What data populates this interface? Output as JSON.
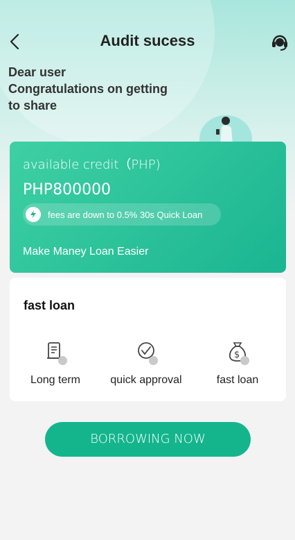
{
  "header": {
    "title": "Audit sucess"
  },
  "greeting": {
    "line1": "Dear user",
    "line2": "Congratulations on getting",
    "line3": "to share"
  },
  "credit": {
    "label": "available credit（PHP)",
    "amount": "PHP800000",
    "fee_text": "fees are down to 0.5% 30s Quick Loan",
    "slogan": "Make Maney Loan Easier"
  },
  "features": {
    "title": "fast loan",
    "items": [
      {
        "label": "Long term",
        "icon": "document-icon"
      },
      {
        "label": "quick approval",
        "icon": "check-circle-icon"
      },
      {
        "label": "fast loan",
        "icon": "money-bag-icon"
      }
    ]
  },
  "cta": {
    "label": "BORROWING NOW"
  },
  "colors": {
    "accent": "#14b58d",
    "card_gradient_start": "#3fd0a4",
    "card_gradient_end": "#1ab591"
  }
}
